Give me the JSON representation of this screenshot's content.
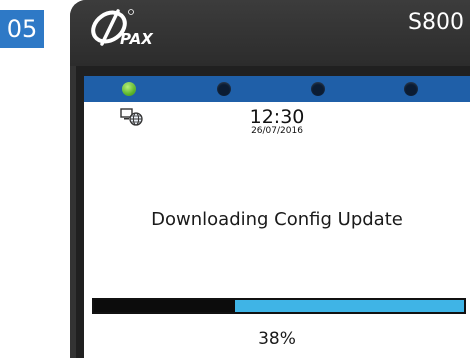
{
  "step": {
    "number": "05",
    "badge_color": "#2e79c6"
  },
  "device": {
    "brand_logo": "pax-logo",
    "model": "S800",
    "body_color": "#333333"
  },
  "status_leds": {
    "bar_color": "#1f5fa8",
    "leds": [
      {
        "name": "status-led-1",
        "state": "on",
        "color": "#5cb52a"
      },
      {
        "name": "status-led-2",
        "state": "off",
        "color": "#0b1c33"
      },
      {
        "name": "status-led-3",
        "state": "off",
        "color": "#0b1c33"
      },
      {
        "name": "status-led-4",
        "state": "off",
        "color": "#0b1c33"
      }
    ]
  },
  "screen": {
    "connection_icon": "network-globe-icon",
    "time": "12:30",
    "date": "26/07/2016",
    "message": "Downloading Config Update",
    "progress": {
      "percent_value": 38,
      "label": "38%",
      "track_color": "#3fb4e6",
      "fill_color": "#0c0c0c"
    }
  }
}
